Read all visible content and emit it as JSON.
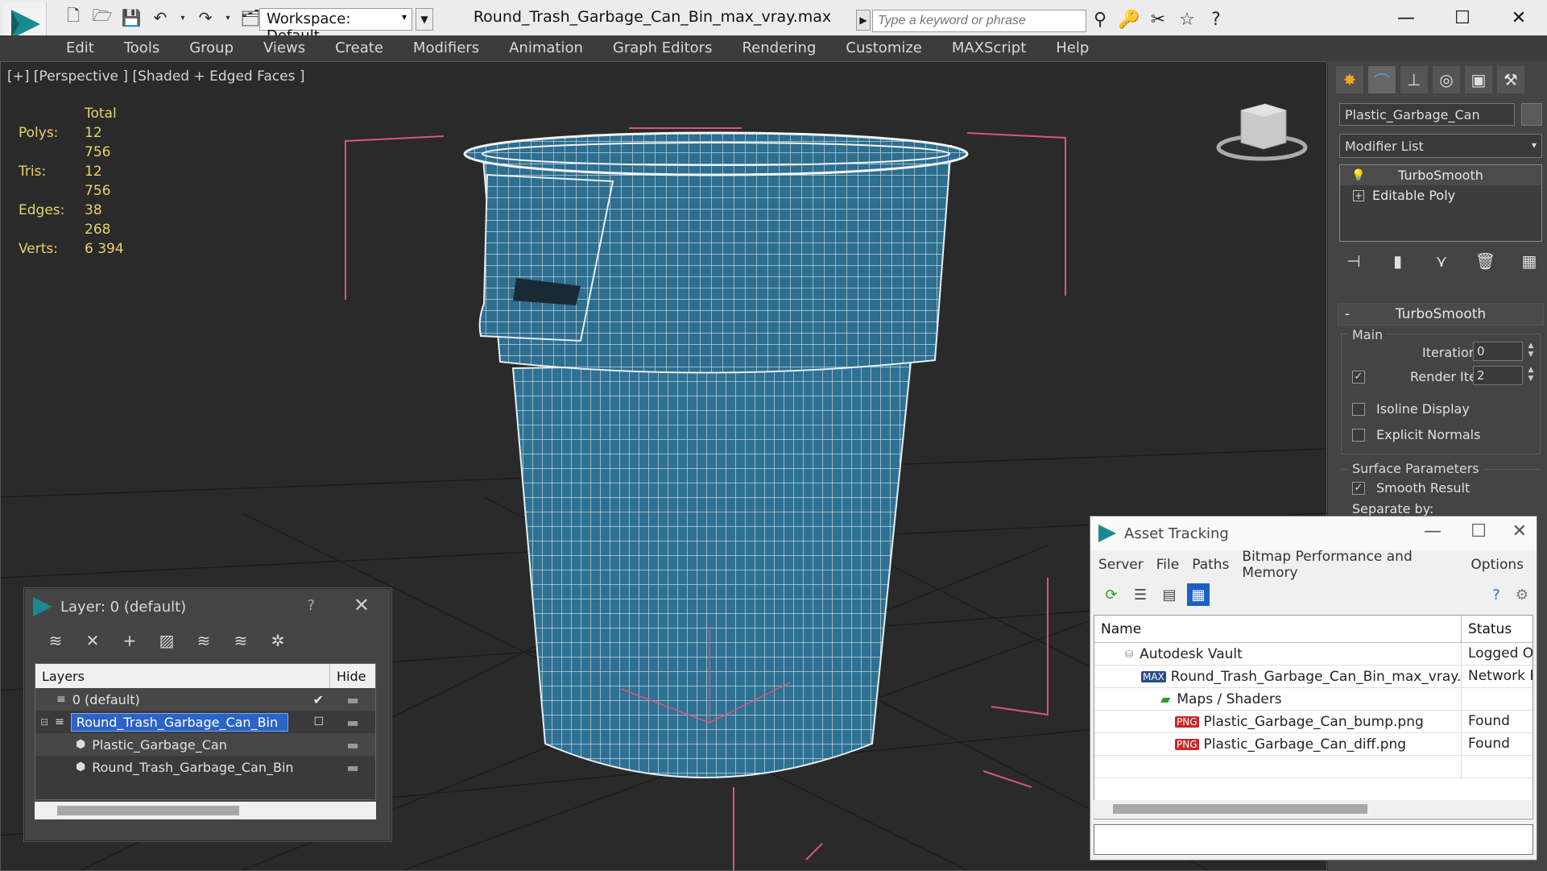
{
  "titlebar": {
    "workspace": "Workspace: Default",
    "document_title": "Round_Trash_Garbage_Can_Bin_max_vray.max",
    "search_placeholder": "Type a keyword or phrase"
  },
  "menu": [
    "Edit",
    "Tools",
    "Group",
    "Views",
    "Create",
    "Modifiers",
    "Animation",
    "Graph Editors",
    "Rendering",
    "Customize",
    "MAXScript",
    "Help"
  ],
  "viewport": {
    "label": "[+] [Perspective ] [Shaded + Edged Faces ]",
    "stats": {
      "header": "Total",
      "rows": [
        {
          "label": "Polys:",
          "value": "12 756"
        },
        {
          "label": "Tris:",
          "value": "12 756"
        },
        {
          "label": "Edges:",
          "value": "38 268"
        },
        {
          "label": "Verts:",
          "value": "6 394"
        }
      ]
    },
    "colors": {
      "mesh": "#2e6e8f",
      "wire": "#d8e6ee",
      "grid": "#1b1b1b",
      "bbox": "#d9567a"
    }
  },
  "command_panel": {
    "object_name": "Plastic_Garbage_Can",
    "modifier_list": "Modifier List",
    "stack": [
      "TurboSmooth",
      "Editable Poly"
    ],
    "rollout_title": "TurboSmooth",
    "main_group": "Main",
    "iterations_label": "Iterations:",
    "iterations_value": "0",
    "render_iters_label": "Render Iters:",
    "render_iters_value": "2",
    "isoline_label": "Isoline Display",
    "explicit_normals_label": "Explicit Normals",
    "surface_group": "Surface Parameters",
    "smooth_result_label": "Smooth Result",
    "separate_by_label": "Separate by:"
  },
  "layer_window": {
    "title": "Layer: 0 (default)",
    "help": "?",
    "col_layers": "Layers",
    "col_hide": "Hide",
    "rows": [
      {
        "name": "0 (default)",
        "indent": 0
      },
      {
        "name": "Round_Trash_Garbage_Can_Bin",
        "indent": 0
      },
      {
        "name": "Plastic_Garbage_Can",
        "indent": 1
      },
      {
        "name": "Round_Trash_Garbage_Can_Bin",
        "indent": 1
      }
    ]
  },
  "asset_window": {
    "title": "Asset Tracking",
    "menu": [
      "Server",
      "File",
      "Paths",
      "Bitmap Performance and Memory",
      "Options"
    ],
    "col_name": "Name",
    "col_status": "Status",
    "rows": [
      {
        "name": "Autodesk Vault",
        "status": "Logged Out",
        "icon": "vault-icon",
        "badge": "",
        "indent": 1
      },
      {
        "name": "Round_Trash_Garbage_Can_Bin_max_vray.max",
        "status": "Network Path",
        "icon": "max-file-icon",
        "badge": "MAX",
        "indent": 2
      },
      {
        "name": "Maps / Shaders",
        "status": "",
        "icon": "folder-icon",
        "badge": "",
        "indent": 3
      },
      {
        "name": "Plastic_Garbage_Can_bump.png",
        "status": "Found",
        "icon": "png-file-icon",
        "badge": "PNG",
        "indent": 4
      },
      {
        "name": "Plastic_Garbage_Can_diff.png",
        "status": "Found",
        "icon": "png-file-icon",
        "badge": "PNG",
        "indent": 4
      }
    ]
  }
}
